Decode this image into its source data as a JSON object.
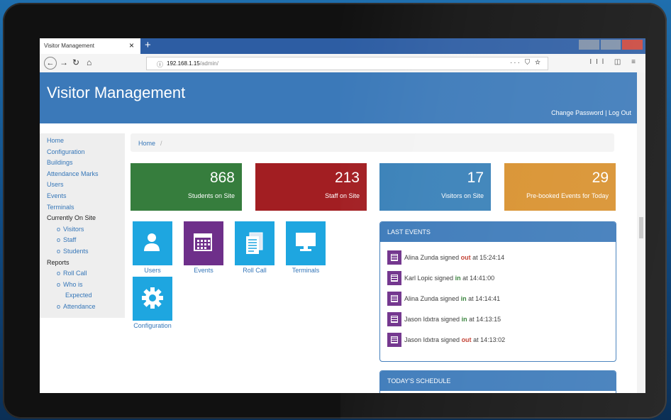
{
  "browser": {
    "tab_title": "Visitor Management",
    "tab_close": "×",
    "new_tab": "+",
    "url_host": "192.168.1.15",
    "url_path": "/admin/",
    "url_right_icons": "··· ⛉ ☆",
    "nav_right_icons": "IIl ◫ ≡"
  },
  "header": {
    "title": "Visitor Management",
    "links": "Change Password | Log Out"
  },
  "sidebar": {
    "items": [
      {
        "label": "Home",
        "type": "link"
      },
      {
        "label": "Configuration",
        "type": "link"
      },
      {
        "label": "Buildings",
        "type": "link"
      },
      {
        "label": "Attendance Marks",
        "type": "link"
      },
      {
        "label": "Users",
        "type": "link"
      },
      {
        "label": "Events",
        "type": "link"
      },
      {
        "label": "Terminals",
        "type": "link"
      },
      {
        "label": "Currently On Site",
        "type": "heading"
      },
      {
        "label": "Visitors",
        "type": "sub"
      },
      {
        "label": "Staff",
        "type": "sub"
      },
      {
        "label": "Students",
        "type": "sub"
      },
      {
        "label": "Reports",
        "type": "heading"
      },
      {
        "label": "Roll Call",
        "type": "sub"
      },
      {
        "label": "Who is",
        "type": "sub"
      },
      {
        "label": "Expected",
        "type": "subcont"
      },
      {
        "label": "Attendance",
        "type": "sub"
      }
    ],
    "bullet": "o"
  },
  "breadcrumb": {
    "home": "Home",
    "sep": "/"
  },
  "stats": [
    {
      "value": "868",
      "label": "Students on Site",
      "color": "#367d3d"
    },
    {
      "value": "213",
      "label": "Staff on Site",
      "color": "#a21e22"
    },
    {
      "value": "17",
      "label": "Visitors on Site",
      "color": "#3880b8"
    },
    {
      "value": "29",
      "label": "Pre-booked Events for Today",
      "color": "#d8902c"
    }
  ],
  "tiles": [
    {
      "label": "Users",
      "icon": "user-icon",
      "color": "#1ea6e0"
    },
    {
      "label": "Events",
      "icon": "calendar-icon",
      "color": "#6e2f8a"
    },
    {
      "label": "Roll Call",
      "icon": "document-icon",
      "color": "#1ea6e0"
    },
    {
      "label": "Terminals",
      "icon": "monitor-icon",
      "color": "#1ea6e0"
    },
    {
      "label": "Configuration",
      "icon": "gear-icon",
      "color": "#1ea6e0"
    }
  ],
  "last_events": {
    "title": "LAST EVENTS",
    "items": [
      {
        "name": "Alina Zunda",
        "pre": " signed ",
        "action": "out",
        "post": " at 15:24:14"
      },
      {
        "name": "Karl Lopic",
        "pre": " signed ",
        "action": "in",
        "post": " at 14:41:00"
      },
      {
        "name": "Alina Zunda",
        "pre": " signed ",
        "action": "in",
        "post": " at 14:14:41"
      },
      {
        "name": "Jason Idxtra",
        "pre": " signed ",
        "action": "in",
        "post": " at 14:13:15"
      },
      {
        "name": "Jason Idxtra",
        "pre": " signed ",
        "action": "out",
        "post": " at 14:13:02"
      }
    ]
  },
  "todays_schedule": {
    "title": "TODAY'S SCHEDULE"
  }
}
